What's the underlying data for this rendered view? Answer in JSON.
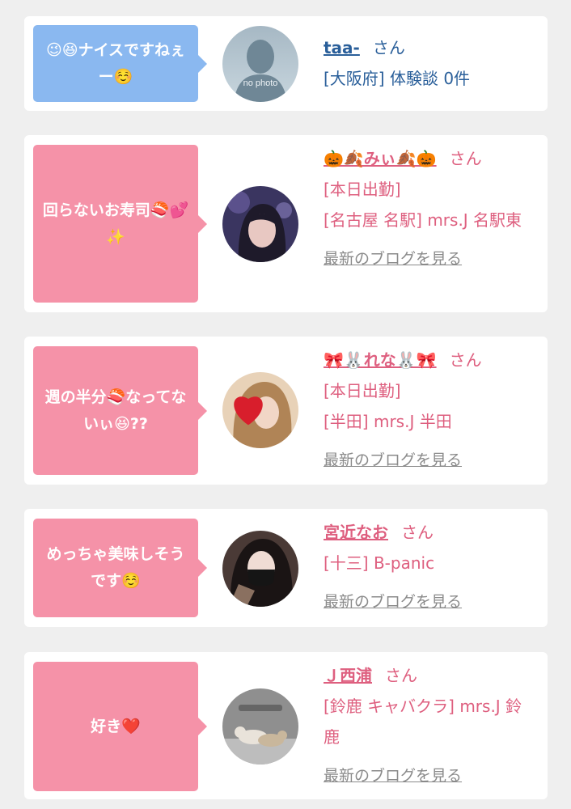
{
  "colors": {
    "blue_bubble": "#8ab8f0",
    "pink_bubble": "#f592a8",
    "blue_text": "#2a5f9a",
    "pink_text": "#de5f7f",
    "link_gray": "#8a8a8a",
    "background": "#efefef"
  },
  "comments": [
    {
      "bubble_text": "😉😆ナイスですねぇー☺️",
      "name": "taa-",
      "honorific": "さん",
      "details": [
        "[大阪府] 体験談 0件"
      ],
      "blog_link": "",
      "avatar": "no-photo-silhouette",
      "avatar_caption": "no photo",
      "theme": "blue"
    },
    {
      "bubble_text": "回らないお寿司🍣💕✨",
      "name": "🎃🍂みぃ🍂🎃",
      "honorific": "さん",
      "details": [
        "[本日出勤]",
        "[名古屋 名駅] mrs.J 名駅東"
      ],
      "blog_link": "最新のブログを見る",
      "avatar": "woman-portrait-dark",
      "theme": "pink"
    },
    {
      "bubble_text": "週の半分🍣なってないぃ😆??",
      "name": "🎀🐰れな🐰🎀",
      "honorific": "さん",
      "details": [
        "[本日出勤]",
        "[半田] mrs.J 半田"
      ],
      "blog_link": "最新のブログを見る",
      "avatar": "woman-portrait-heart",
      "theme": "pink"
    },
    {
      "bubble_text": "めっちゃ美味しそうです☺️",
      "name": "宮近なお",
      "honorific": "さん",
      "details": [
        "[十三] B-panic"
      ],
      "blog_link": "最新のブログを見る",
      "avatar": "woman-portrait-mask",
      "theme": "pink"
    },
    {
      "bubble_text": "好き❤️",
      "name": "Ｊ西浦",
      "honorific": "さん",
      "details": [
        "[鈴鹿 キャバクラ] mrs.J 鈴鹿"
      ],
      "blog_link": "最新のブログを見る",
      "avatar": "cats-photo",
      "theme": "pink"
    }
  ]
}
